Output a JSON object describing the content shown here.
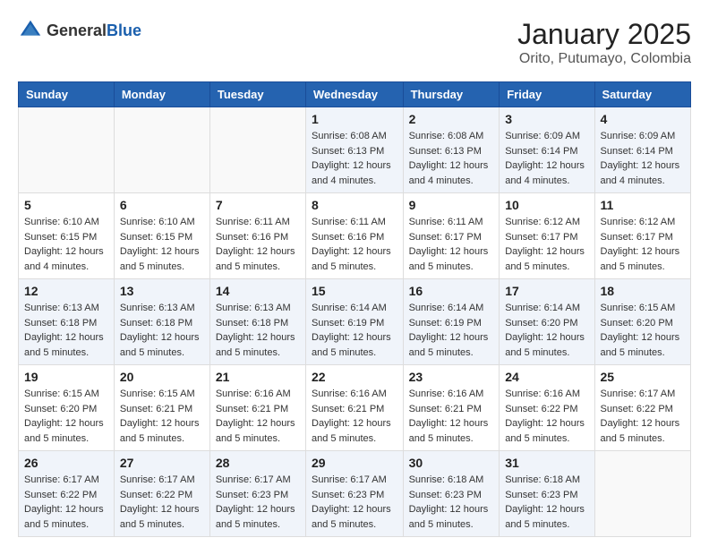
{
  "header": {
    "logo_general": "General",
    "logo_blue": "Blue",
    "month_title": "January 2025",
    "location": "Orito, Putumayo, Colombia"
  },
  "weekdays": [
    "Sunday",
    "Monday",
    "Tuesday",
    "Wednesday",
    "Thursday",
    "Friday",
    "Saturday"
  ],
  "weeks": [
    [
      {
        "day": "",
        "info": ""
      },
      {
        "day": "",
        "info": ""
      },
      {
        "day": "",
        "info": ""
      },
      {
        "day": "1",
        "info": "Sunrise: 6:08 AM\nSunset: 6:13 PM\nDaylight: 12 hours\nand 4 minutes."
      },
      {
        "day": "2",
        "info": "Sunrise: 6:08 AM\nSunset: 6:13 PM\nDaylight: 12 hours\nand 4 minutes."
      },
      {
        "day": "3",
        "info": "Sunrise: 6:09 AM\nSunset: 6:14 PM\nDaylight: 12 hours\nand 4 minutes."
      },
      {
        "day": "4",
        "info": "Sunrise: 6:09 AM\nSunset: 6:14 PM\nDaylight: 12 hours\nand 4 minutes."
      }
    ],
    [
      {
        "day": "5",
        "info": "Sunrise: 6:10 AM\nSunset: 6:15 PM\nDaylight: 12 hours\nand 4 minutes."
      },
      {
        "day": "6",
        "info": "Sunrise: 6:10 AM\nSunset: 6:15 PM\nDaylight: 12 hours\nand 5 minutes."
      },
      {
        "day": "7",
        "info": "Sunrise: 6:11 AM\nSunset: 6:16 PM\nDaylight: 12 hours\nand 5 minutes."
      },
      {
        "day": "8",
        "info": "Sunrise: 6:11 AM\nSunset: 6:16 PM\nDaylight: 12 hours\nand 5 minutes."
      },
      {
        "day": "9",
        "info": "Sunrise: 6:11 AM\nSunset: 6:17 PM\nDaylight: 12 hours\nand 5 minutes."
      },
      {
        "day": "10",
        "info": "Sunrise: 6:12 AM\nSunset: 6:17 PM\nDaylight: 12 hours\nand 5 minutes."
      },
      {
        "day": "11",
        "info": "Sunrise: 6:12 AM\nSunset: 6:17 PM\nDaylight: 12 hours\nand 5 minutes."
      }
    ],
    [
      {
        "day": "12",
        "info": "Sunrise: 6:13 AM\nSunset: 6:18 PM\nDaylight: 12 hours\nand 5 minutes."
      },
      {
        "day": "13",
        "info": "Sunrise: 6:13 AM\nSunset: 6:18 PM\nDaylight: 12 hours\nand 5 minutes."
      },
      {
        "day": "14",
        "info": "Sunrise: 6:13 AM\nSunset: 6:18 PM\nDaylight: 12 hours\nand 5 minutes."
      },
      {
        "day": "15",
        "info": "Sunrise: 6:14 AM\nSunset: 6:19 PM\nDaylight: 12 hours\nand 5 minutes."
      },
      {
        "day": "16",
        "info": "Sunrise: 6:14 AM\nSunset: 6:19 PM\nDaylight: 12 hours\nand 5 minutes."
      },
      {
        "day": "17",
        "info": "Sunrise: 6:14 AM\nSunset: 6:20 PM\nDaylight: 12 hours\nand 5 minutes."
      },
      {
        "day": "18",
        "info": "Sunrise: 6:15 AM\nSunset: 6:20 PM\nDaylight: 12 hours\nand 5 minutes."
      }
    ],
    [
      {
        "day": "19",
        "info": "Sunrise: 6:15 AM\nSunset: 6:20 PM\nDaylight: 12 hours\nand 5 minutes."
      },
      {
        "day": "20",
        "info": "Sunrise: 6:15 AM\nSunset: 6:21 PM\nDaylight: 12 hours\nand 5 minutes."
      },
      {
        "day": "21",
        "info": "Sunrise: 6:16 AM\nSunset: 6:21 PM\nDaylight: 12 hours\nand 5 minutes."
      },
      {
        "day": "22",
        "info": "Sunrise: 6:16 AM\nSunset: 6:21 PM\nDaylight: 12 hours\nand 5 minutes."
      },
      {
        "day": "23",
        "info": "Sunrise: 6:16 AM\nSunset: 6:21 PM\nDaylight: 12 hours\nand 5 minutes."
      },
      {
        "day": "24",
        "info": "Sunrise: 6:16 AM\nSunset: 6:22 PM\nDaylight: 12 hours\nand 5 minutes."
      },
      {
        "day": "25",
        "info": "Sunrise: 6:17 AM\nSunset: 6:22 PM\nDaylight: 12 hours\nand 5 minutes."
      }
    ],
    [
      {
        "day": "26",
        "info": "Sunrise: 6:17 AM\nSunset: 6:22 PM\nDaylight: 12 hours\nand 5 minutes."
      },
      {
        "day": "27",
        "info": "Sunrise: 6:17 AM\nSunset: 6:22 PM\nDaylight: 12 hours\nand 5 minutes."
      },
      {
        "day": "28",
        "info": "Sunrise: 6:17 AM\nSunset: 6:23 PM\nDaylight: 12 hours\nand 5 minutes."
      },
      {
        "day": "29",
        "info": "Sunrise: 6:17 AM\nSunset: 6:23 PM\nDaylight: 12 hours\nand 5 minutes."
      },
      {
        "day": "30",
        "info": "Sunrise: 6:18 AM\nSunset: 6:23 PM\nDaylight: 12 hours\nand 5 minutes."
      },
      {
        "day": "31",
        "info": "Sunrise: 6:18 AM\nSunset: 6:23 PM\nDaylight: 12 hours\nand 5 minutes."
      },
      {
        "day": "",
        "info": ""
      }
    ]
  ]
}
